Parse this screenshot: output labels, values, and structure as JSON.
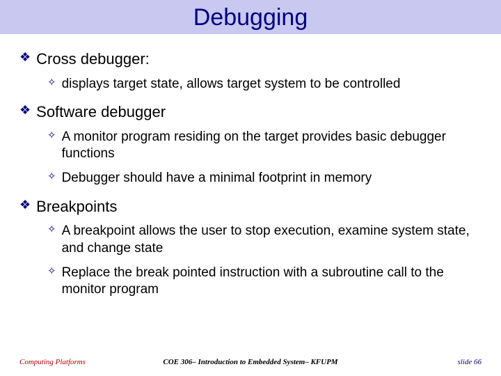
{
  "title": "Debugging",
  "bullets": [
    {
      "text": "Cross debugger:",
      "children": [
        {
          "text": "displays target state, allows target system to be controlled"
        }
      ]
    },
    {
      "text": "Software debugger",
      "children": [
        {
          "text": "A monitor program residing on the target provides basic debugger functions"
        },
        {
          "text": "Debugger should have a minimal footprint in memory"
        }
      ]
    },
    {
      "text": "Breakpoints",
      "children": [
        {
          "text": "A breakpoint allows the user to stop execution, examine system state, and change state"
        },
        {
          "text": "Replace the break pointed instruction with a subroutine call to the monitor program"
        }
      ]
    }
  ],
  "footer": {
    "left": "Computing Platforms",
    "center": "COE 306– Introduction to Embedded System– KFUPM",
    "right": "slide 66"
  }
}
